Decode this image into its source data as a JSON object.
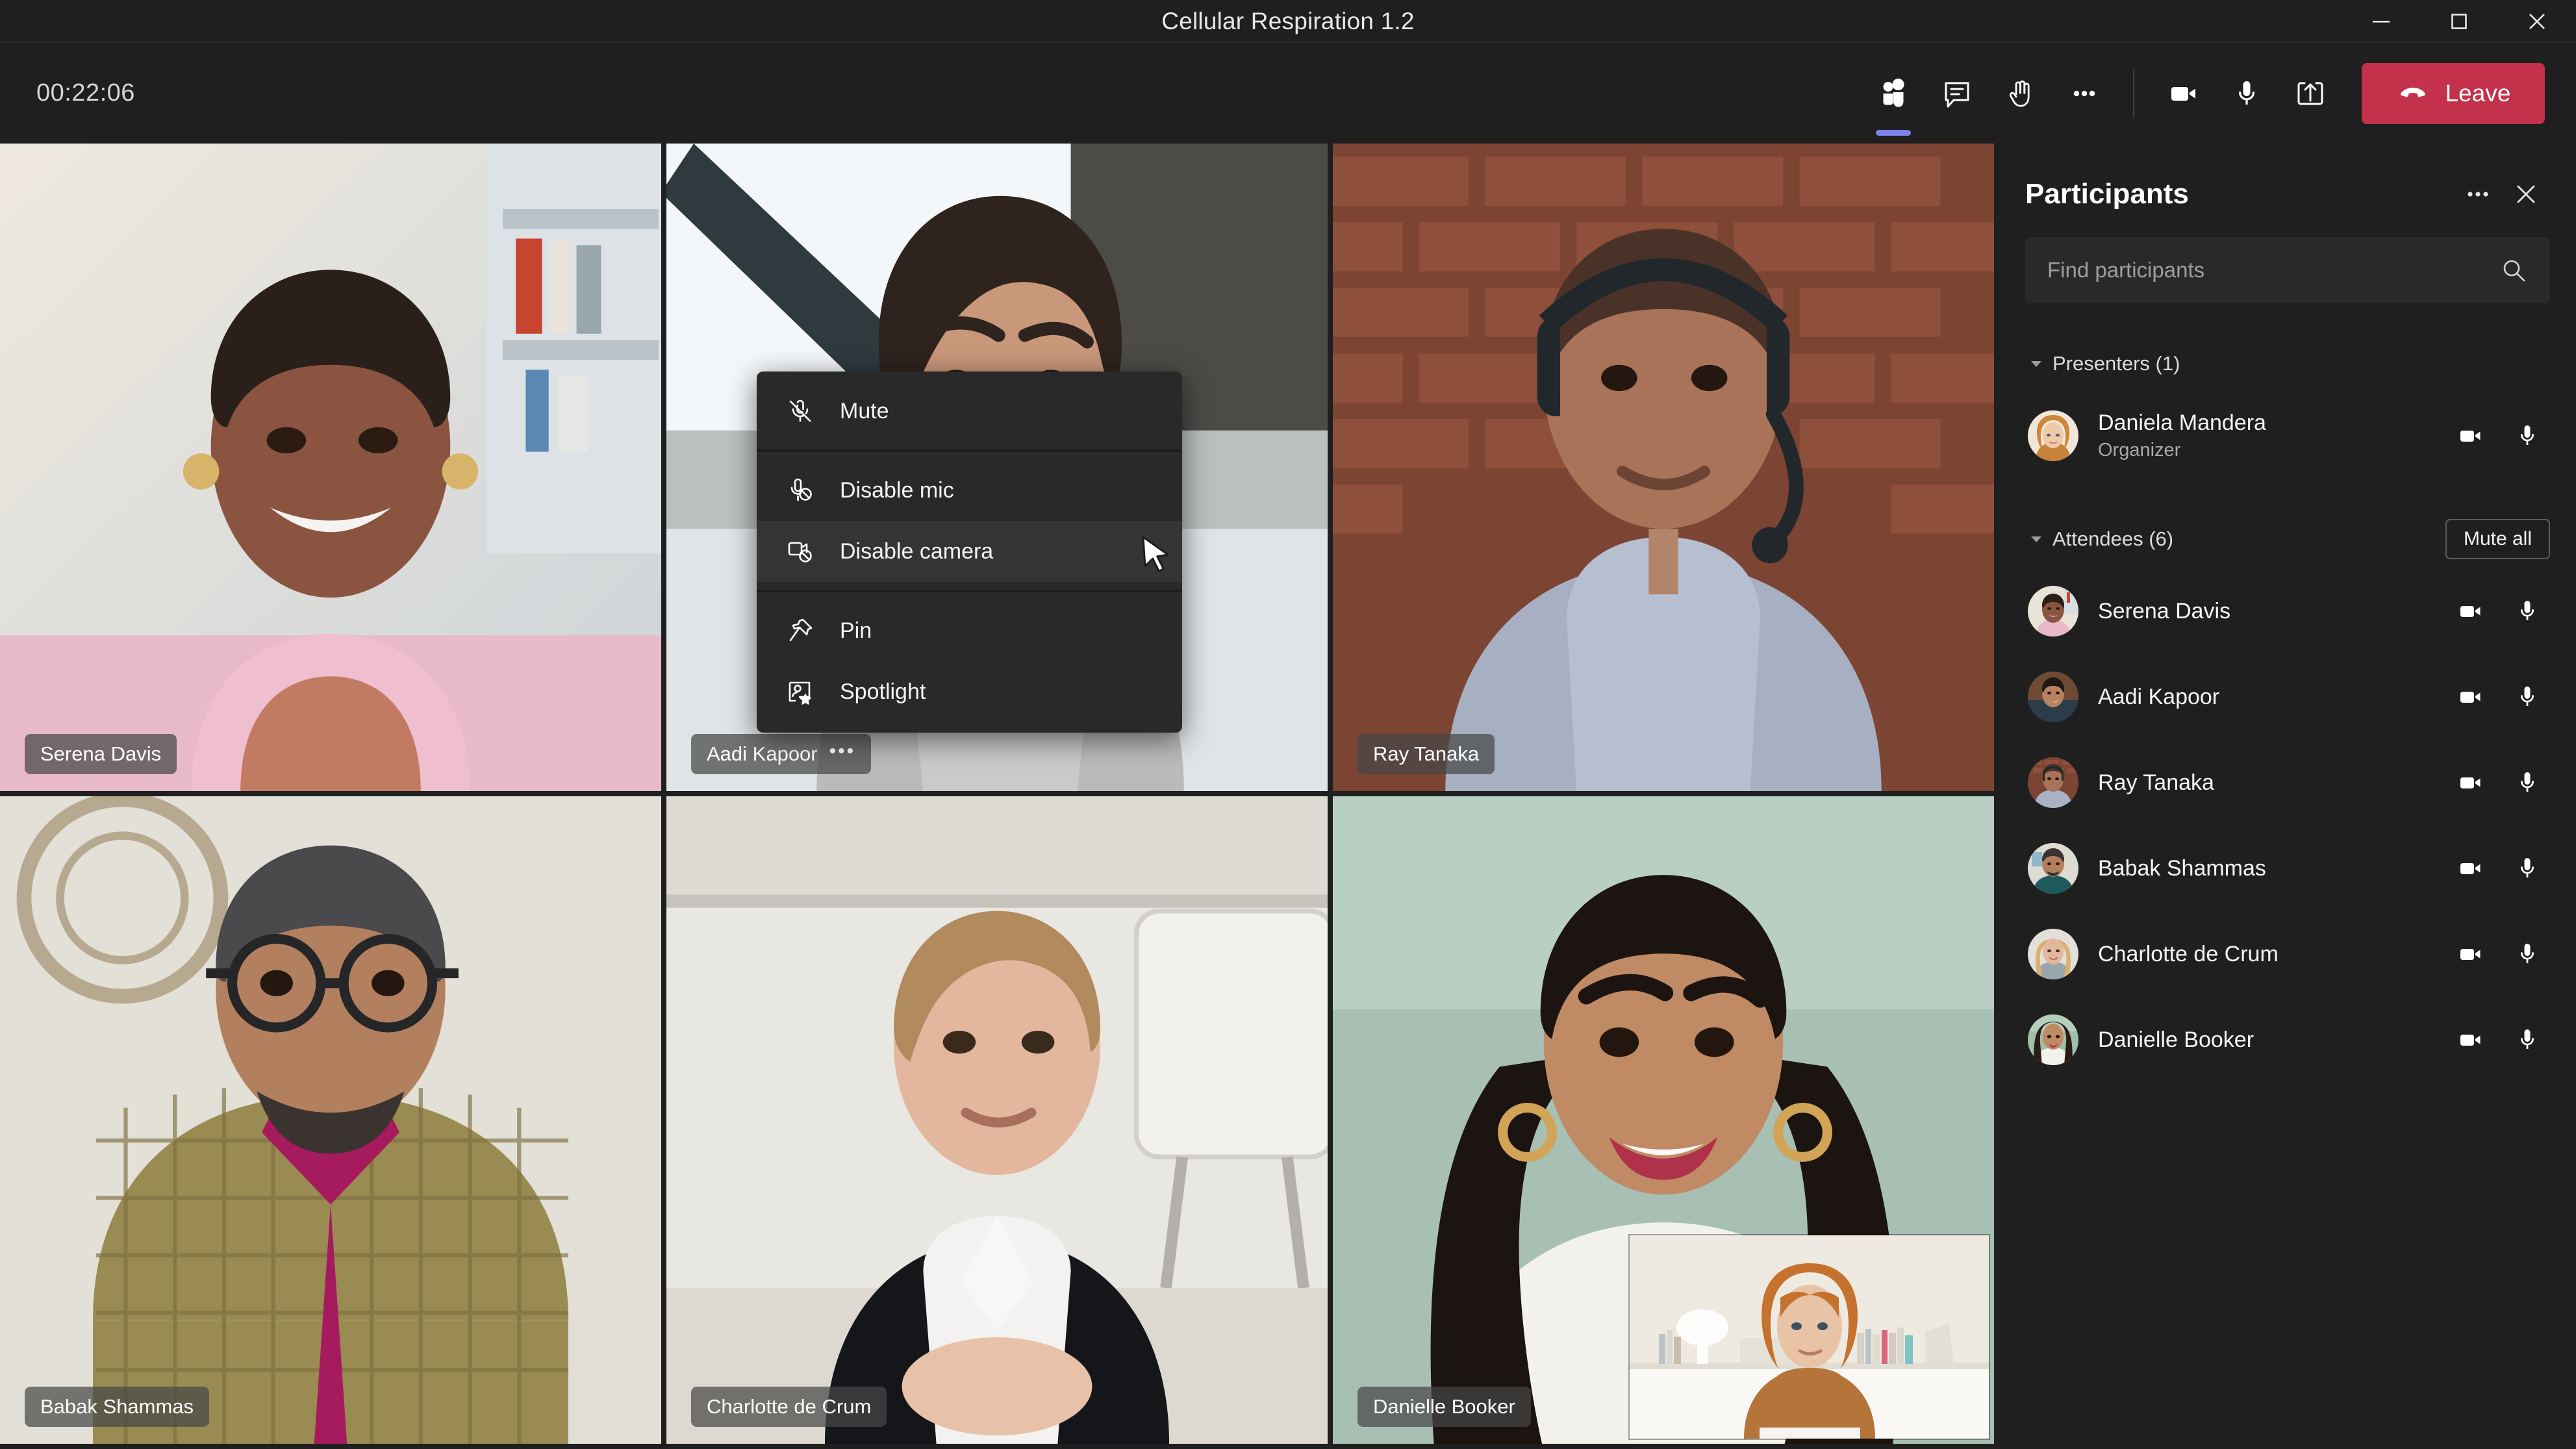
{
  "window": {
    "title": "Cellular Respiration 1.2",
    "controls": [
      {
        "name": "minimize",
        "glyph": "minimize-icon"
      },
      {
        "name": "maximize",
        "glyph": "maximize-icon"
      },
      {
        "name": "close",
        "glyph": "close-icon"
      }
    ]
  },
  "toolbar": {
    "timer": "00:22:06",
    "buttons": [
      {
        "name": "people-icon",
        "label": "Show participants",
        "active": true
      },
      {
        "name": "chat-icon",
        "label": "Show conversation",
        "active": false
      },
      {
        "name": "raise-hand-icon",
        "label": "Raise hand",
        "active": false
      },
      {
        "name": "more-options-icon",
        "label": "More actions",
        "active": false
      },
      {
        "name": "camera-icon",
        "label": "Turn camera off",
        "active": false
      },
      {
        "name": "microphone-icon",
        "label": "Mute",
        "active": false
      },
      {
        "name": "share-screen-icon",
        "label": "Share content",
        "active": false
      }
    ],
    "leave_label": "Leave",
    "accent_color": "#7b83eb",
    "leave_color": "#c4314b"
  },
  "grid": {
    "tiles": [
      {
        "name": "Serena Davis",
        "has_menu": false
      },
      {
        "name": "Aadi Kapoor",
        "has_menu": true,
        "menu_glyph": "•••"
      },
      {
        "name": "Ray Tanaka",
        "has_menu": false
      },
      {
        "name": "Babak Shammas",
        "has_menu": false
      },
      {
        "name": "Charlotte de Crum",
        "has_menu": false
      },
      {
        "name": "Danielle Booker",
        "has_menu": false
      }
    ]
  },
  "context_menu": {
    "target": "Aadi Kapoor",
    "items": [
      {
        "label": "Mute",
        "icon": "microphone-muted-icon",
        "highlighted": false
      },
      {
        "label": "Disable mic",
        "icon": "mic-disabled-icon",
        "highlighted": false
      },
      {
        "label": "Disable camera",
        "icon": "camera-disabled-icon",
        "highlighted": true
      },
      {
        "label": "Pin",
        "icon": "pin-icon",
        "highlighted": false
      },
      {
        "label": "Spotlight",
        "icon": "spotlight-icon",
        "highlighted": false
      }
    ]
  },
  "panel": {
    "title": "Participants",
    "more_label": "More options",
    "close_label": "Close",
    "search": {
      "placeholder": "Find participants",
      "value": ""
    },
    "sections": [
      {
        "label": "Presenters (1)",
        "expanded": true,
        "action": null,
        "people": [
          {
            "name": "Daniela Mandera",
            "role": "Organizer",
            "camera": "camera-icon",
            "mic": "microphone-icon"
          }
        ]
      },
      {
        "label": "Attendees (6)",
        "expanded": true,
        "action": "Mute all",
        "people": [
          {
            "name": "Serena Davis",
            "role": "",
            "camera": "camera-icon",
            "mic": "microphone-icon"
          },
          {
            "name": "Aadi Kapoor",
            "role": "",
            "camera": "camera-icon",
            "mic": "microphone-icon"
          },
          {
            "name": "Ray Tanaka",
            "role": "",
            "camera": "camera-icon",
            "mic": "microphone-icon"
          },
          {
            "name": "Babak Shammas",
            "role": "",
            "camera": "camera-icon",
            "mic": "microphone-icon"
          },
          {
            "name": "Charlotte de Crum",
            "role": "",
            "camera": "camera-icon",
            "mic": "microphone-icon"
          },
          {
            "name": "Danielle Booker",
            "role": "",
            "camera": "camera-icon",
            "mic": "microphone-icon"
          }
        ]
      }
    ]
  }
}
